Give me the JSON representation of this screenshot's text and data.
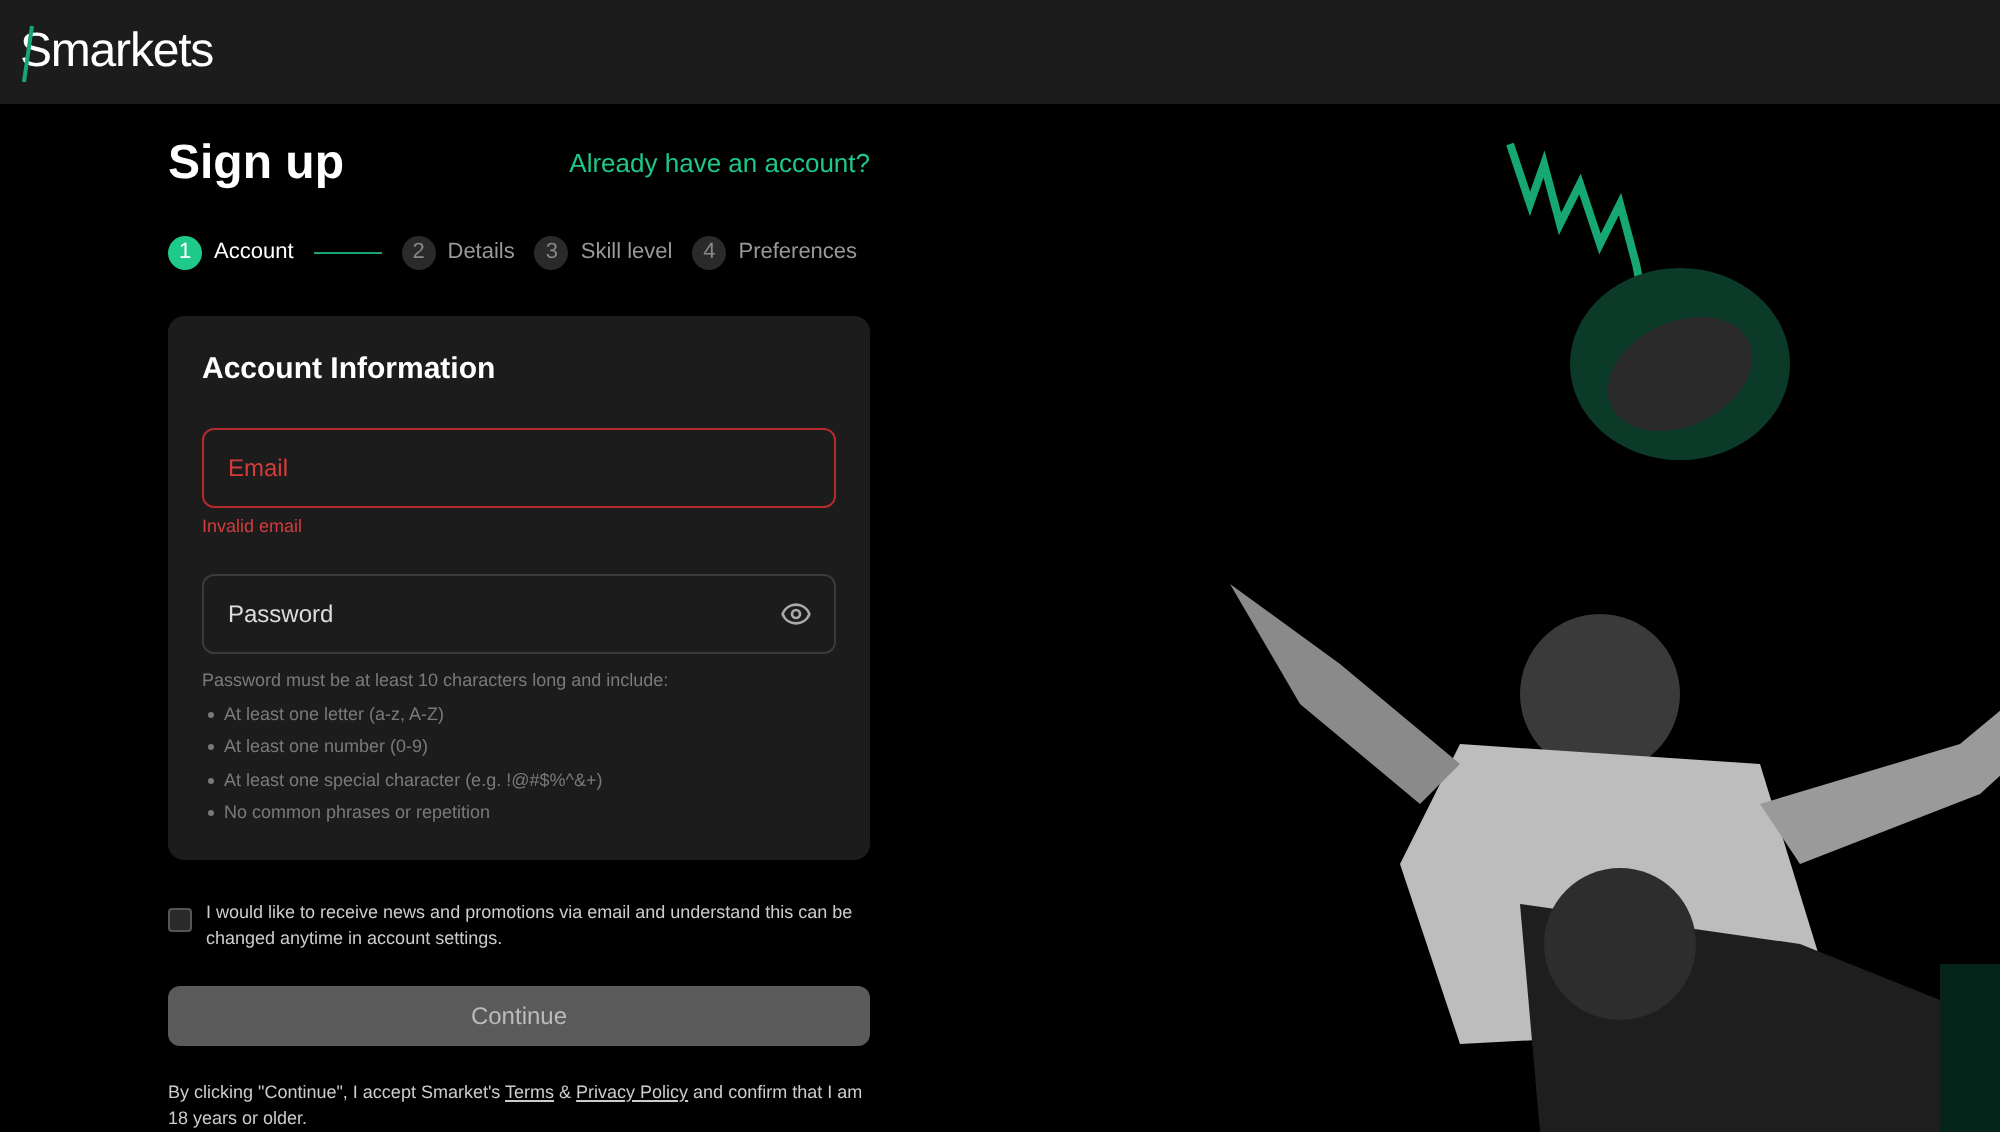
{
  "header": {
    "logo": "Smarkets"
  },
  "title": "Sign up",
  "login_link": "Already have an account?",
  "steps": [
    {
      "number": "1",
      "label": "Account",
      "selected": true
    },
    {
      "number": "2",
      "label": "Details",
      "selected": false
    },
    {
      "number": "3",
      "label": "Skill level",
      "selected": false
    },
    {
      "number": "4",
      "label": "Preferences",
      "selected": false
    }
  ],
  "card": {
    "title": "Account Information",
    "email": {
      "placeholder": "Email",
      "invalid": true,
      "error": "Invalid email"
    },
    "password": {
      "placeholder": "Password"
    },
    "rules_intro": "Password must be at least 10 characters long and include:",
    "rules": [
      "At least one letter (a-z, A-Z)",
      "At least one number (0-9)",
      "At least one special character (e.g. !@#$%^&+)",
      "No common phrases or repetition"
    ]
  },
  "newsletter": {
    "label": "I would like to receive news and promotions via email and understand this can be changed anytime in account settings.",
    "checked": false
  },
  "continue": {
    "label": "Continue",
    "disabled": true
  },
  "legal": [
    {
      "kind": "text",
      "text": "By clicking \"Continue\", I accept Smarket's "
    },
    {
      "kind": "link",
      "text": "Terms"
    },
    {
      "kind": "text",
      "text": " & "
    },
    {
      "kind": "link",
      "text": "Privacy Policy"
    },
    {
      "kind": "text",
      "text": " and confirm that I am 18 years or older."
    }
  ]
}
